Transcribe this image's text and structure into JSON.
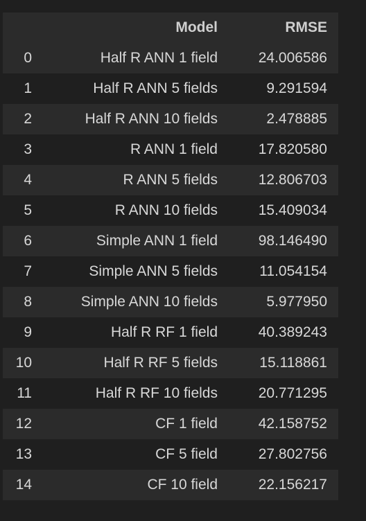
{
  "table": {
    "columns": [
      "",
      "Model",
      "RMSE"
    ],
    "rows": [
      {
        "index": "0",
        "model": "Half R ANN 1 field",
        "rmse": "24.006586"
      },
      {
        "index": "1",
        "model": "Half R ANN 5 fields",
        "rmse": "9.291594"
      },
      {
        "index": "2",
        "model": "Half R ANN 10 fields",
        "rmse": "2.478885"
      },
      {
        "index": "3",
        "model": "R ANN 1 field",
        "rmse": "17.820580"
      },
      {
        "index": "4",
        "model": "R ANN 5 fields",
        "rmse": "12.806703"
      },
      {
        "index": "5",
        "model": "R ANN 10 fields",
        "rmse": "15.409034"
      },
      {
        "index": "6",
        "model": "Simple ANN 1 field",
        "rmse": "98.146490"
      },
      {
        "index": "7",
        "model": "Simple ANN 5 fields",
        "rmse": "11.054154"
      },
      {
        "index": "8",
        "model": "Simple ANN 10 fields",
        "rmse": "5.977950"
      },
      {
        "index": "9",
        "model": "Half R RF 1 field",
        "rmse": "40.389243"
      },
      {
        "index": "10",
        "model": "Half R RF 5 fields",
        "rmse": "15.118861"
      },
      {
        "index": "11",
        "model": "Half R RF 10 fields",
        "rmse": "20.771295"
      },
      {
        "index": "12",
        "model": "CF 1 field",
        "rmse": "42.158752"
      },
      {
        "index": "13",
        "model": "CF 5 field",
        "rmse": "27.802756"
      },
      {
        "index": "14",
        "model": "CF 10 field",
        "rmse": "22.156217"
      }
    ]
  }
}
